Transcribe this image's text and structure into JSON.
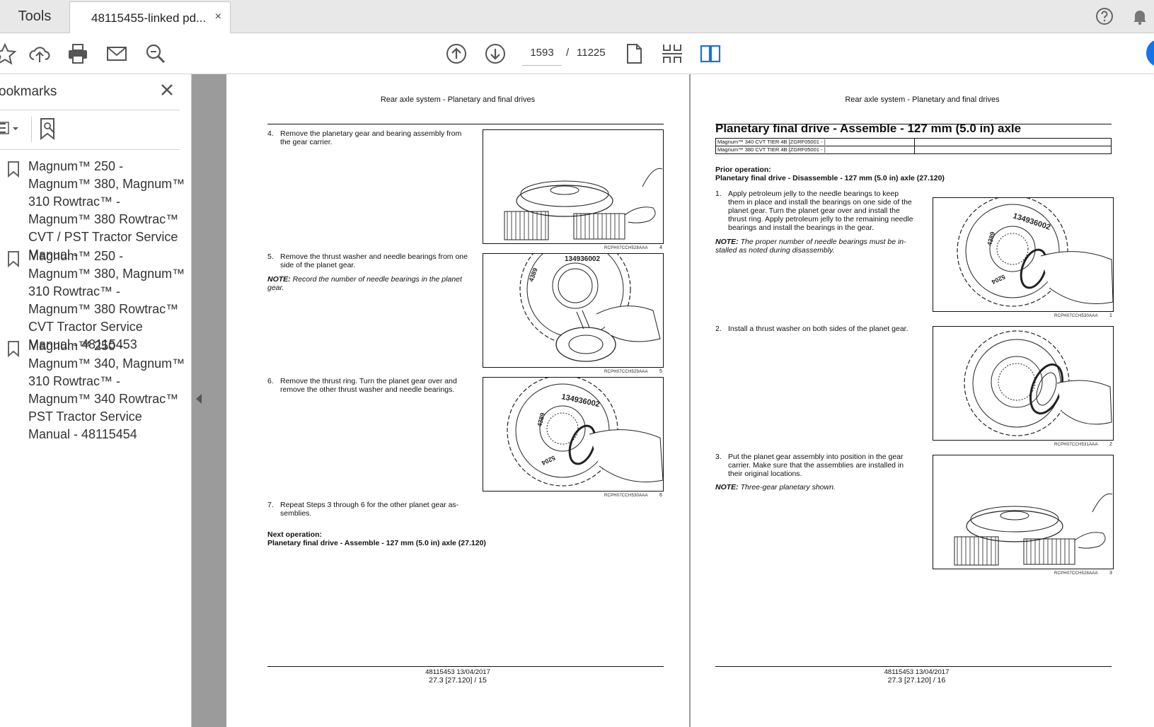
{
  "tabs": {
    "tools_label": "Tools",
    "doc_label": "48115455-linked pd...",
    "close_glyph": "×"
  },
  "toolbar": {
    "current_page": "1593",
    "page_separator": "/",
    "total_pages": "11225",
    "icons": [
      "star-icon",
      "upload-icon",
      "print-icon",
      "mail-icon",
      "zoom-icon",
      "page-up-icon",
      "page-down-icon",
      "single-page-icon",
      "scroll-mode-icon",
      "two-page-icon",
      "help-icon",
      "bell-icon"
    ]
  },
  "sidebar": {
    "title": "ookmarks",
    "close_glyph": "✕",
    "bookmarks": [
      {
        "label": "Magnum™ 250 - Magnum™ 380, Magnum™ 310 Rowtrac™ - Magnum™ 380 Rowtrac™ CVT / PST Tractor Service Manual -"
      },
      {
        "label": "Magnum™ 250 - Magnum™ 380, Magnum™ 310 Rowtrac™ - Magnum™ 380 Rowtrac™ CVT Tractor Service Manual - 48115453"
      },
      {
        "label": "Magnum™ 250 - Magnum™ 340, Magnum™ 310 Rowtrac™ - Magnum™ 340 Rowtrac™ PST Tractor Service Manual - 48115454"
      }
    ]
  },
  "left_page": {
    "header": "Rear axle system - Planetary and final drives",
    "steps": [
      {
        "num": "4.",
        "text": "Remove the planetary gear and bearing assembly from the gear carrier."
      },
      {
        "num": "5.",
        "text": "Remove the thrust washer and needle bearings from one side of the planet gear."
      },
      {
        "num": "6.",
        "text": "Remove the thrust ring. Turn the planet gear over and remove the other thrust washer and needle bearings."
      },
      {
        "num": "7.",
        "text": "Repeat Steps 3 through 6 for the other planet gear as-semblies."
      }
    ],
    "note_label": "NOTE:",
    "note_text": "Record the number of needle bearings in the planet gear.",
    "figures": [
      {
        "caption": "RCPH07CCH528AAA",
        "num": "4"
      },
      {
        "caption": "RCPH07CCH529AAA",
        "num": "5"
      },
      {
        "caption": "RCPH07CCH530AAA",
        "num": "6"
      }
    ],
    "next_label": "Next operation:",
    "next_text": "Planetary final drive - Assemble - 127 mm (5.0 in) axle (27.120)",
    "footer_line1": "48115453 13/04/2017",
    "footer_line2": "27.3 [27.120] / 15"
  },
  "right_page": {
    "header": "Rear axle system - Planetary and final drives",
    "title": "Planetary final drive - Assemble - 127 mm (5.0 in) axle",
    "models": [
      "Magnum™ 340 CVT TIER 4B [ZGRF05001 - ]",
      "Magnum™ 380 CVT TIER 4B [ZGRF05001 - ]"
    ],
    "prior_label": "Prior operation:",
    "prior_text": "Planetary final drive - Disassemble - 127 mm (5.0 in) axle (27.120)",
    "steps": [
      {
        "num": "1.",
        "text": "Apply petroleum jelly to the needle bearings to keep them in place and install the bearings on one side of the planet gear. Turn the planet gear over and install the thrust ring. Apply petroleum jelly to the remaining needle bearings and install the bearings in the gear."
      },
      {
        "num": "2.",
        "text": "Install a thrust washer on both sides of the planet gear."
      },
      {
        "num": "3.",
        "text": "Put the planet gear assembly into position in the gear carrier. Make sure that the assemblies are installed in their original locations."
      }
    ],
    "note1_label": "NOTE:",
    "note1_text": "The proper number of needle bearings must be in-stalled as noted during disassembly.",
    "note2_label": "NOTE:",
    "note2_text": "Three-gear planetary shown.",
    "figures": [
      {
        "caption": "RCPH07CCH530AAA",
        "num": "1"
      },
      {
        "caption": "RCPH07CCH531AAA",
        "num": "2"
      },
      {
        "caption": "RCPH07CCH528AAA",
        "num": "3"
      }
    ],
    "footer_line1": "48115453 13/04/2017",
    "footer_line2": "27.3 [27.120] / 16"
  },
  "gear_labels": {
    "a": "134936002",
    "b": "4389",
    "c": "5204"
  },
  "colors": {
    "accent": "#1473e6",
    "viewer_bg": "#9b9b9b"
  }
}
